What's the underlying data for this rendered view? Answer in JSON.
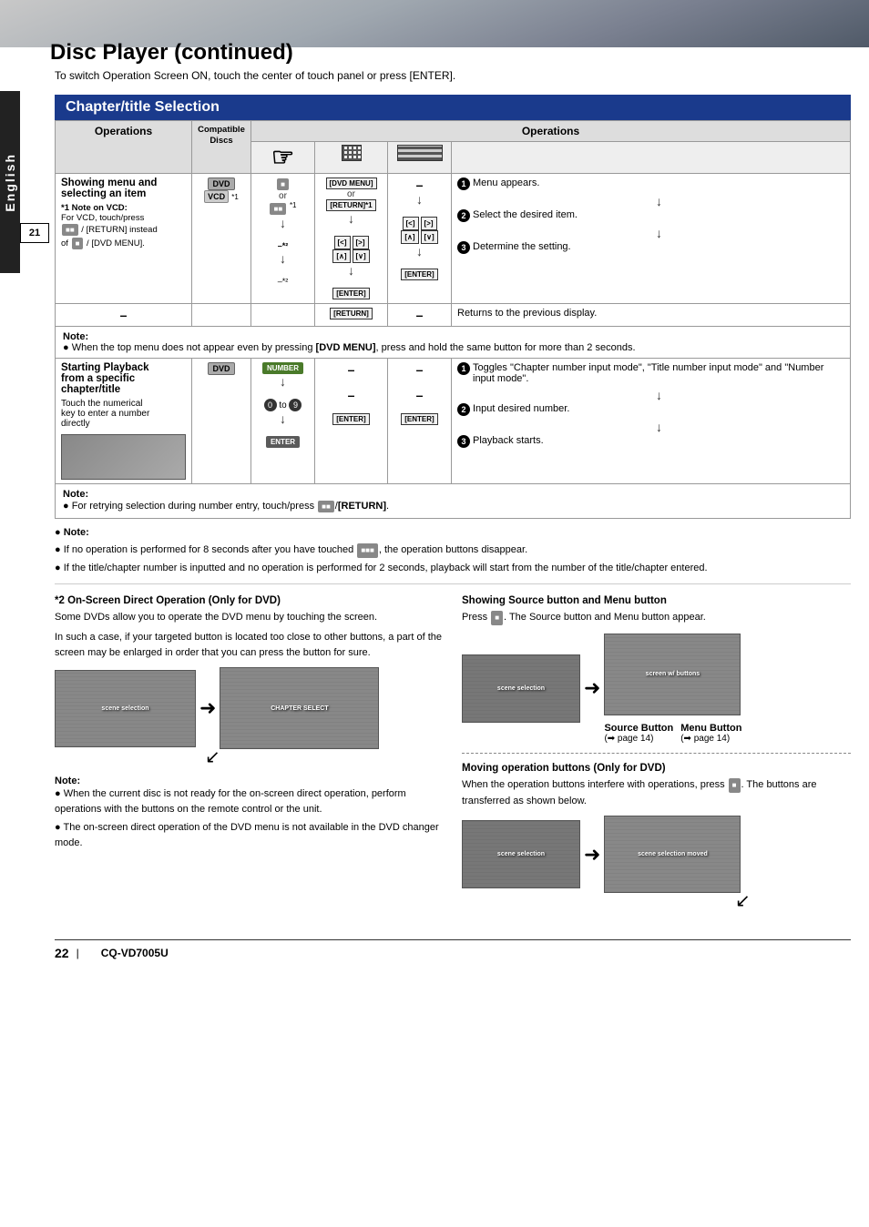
{
  "page": {
    "title": "Disc Player",
    "title_continued": "(continued)",
    "subtitle": "To switch Operation Screen ON, touch the center of touch panel or press [ENTER].",
    "page_number": "21",
    "footer_page": "22",
    "footer_model": "CQ-VD7005U"
  },
  "section": {
    "title": "Chapter/title Selection"
  },
  "table": {
    "header_ops": "Operations",
    "col_operations": "Operations",
    "col_compatible": "Compatible Discs",
    "rows": [
      {
        "label": "Showing menu and selecting an item",
        "note_title": "*1 Note on VCD:",
        "note_body": "For VCD, touch/press  / [RETURN] instead of  / [DVD MENU].",
        "compatible": "DVD VCD *1",
        "steps": [
          "Menu appears.",
          "Select the desired item.",
          "Determine the setting."
        ],
        "return_row": "Returns to the previous display.",
        "note": "When the top menu does not appear even by pressing [DVD MENU], press and hold the same button for more than 2 seconds."
      },
      {
        "label": "Starting Playback from a specific chapter/title",
        "sublabel": "Touch the numerical key to enter a number directly",
        "compatible": "DVD",
        "steps": [
          "Toggles \"Chapter number input mode\", \"Title number input mode\" and \"Number input mode\".",
          "Input desired number.",
          "Playback starts."
        ],
        "note": "For retrying selection during number entry, touch/press  /[RETURN]."
      }
    ]
  },
  "bottom_notes": {
    "title": "Note:",
    "items": [
      "If no operation is performed for 8 seconds after you have touched  , the operation buttons disappear.",
      "If the title/chapter number is inputted and no operation is performed for 2 seconds, playback will start from the number of the title/chapter entered."
    ]
  },
  "left_col": {
    "title": "*2 On-Screen Direct Operation (Only for DVD)",
    "body1": "Some DVDs allow you to operate the DVD menu by touching the screen.",
    "body2": "In such a case, if your targeted button is located too close to other buttons, a part of the screen may be enlarged in order that you can press the button for sure.",
    "note_title": "Note:",
    "note_items": [
      "When the current disc is not ready for the on-screen direct operation, perform operations with the buttons on the remote control or the unit.",
      "The on-screen direct operation of the DVD menu is not available in the DVD changer mode."
    ]
  },
  "right_col": {
    "title": "Showing Source button and Menu button",
    "body": "Press  . The Source button and Menu button appear.",
    "source_label": "Source Button",
    "source_ref": "(➡ page 14)",
    "menu_label": "Menu Button",
    "menu_ref": "(➡ page 14)",
    "moving_title": "Moving operation buttons (Only for DVD)",
    "moving_body": "When the operation buttons interfere with operations, press  . The buttons are transferred as shown below."
  }
}
